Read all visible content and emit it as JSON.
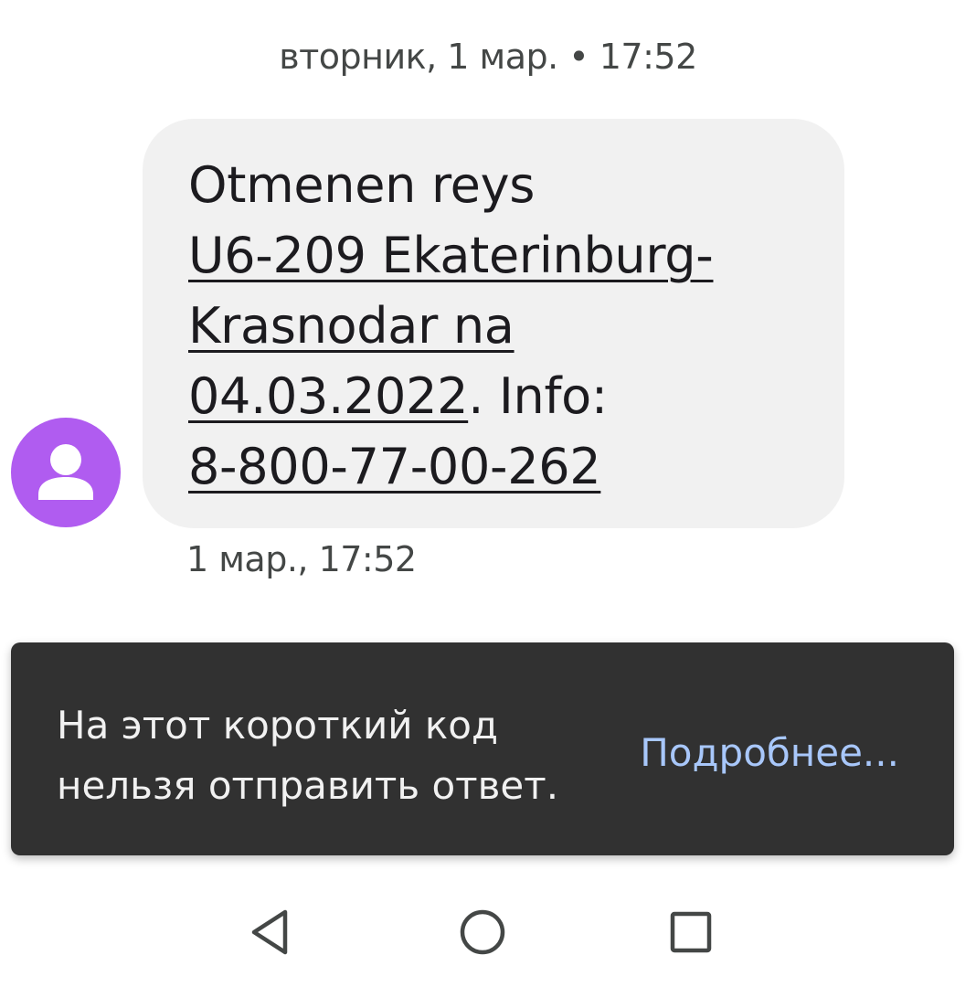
{
  "thread": {
    "date_header": "вторник, 1 мар. • 17:52"
  },
  "message": {
    "line1": "Otmenen reys",
    "flight_link": "U6-209 Ekaterinburg-",
    "flight_link_cont": "Krasnodar na",
    "date_link": "04.03.2022",
    "info_text": ". Info:",
    "phone_link": "8-800-77-00-262",
    "timestamp": "1 мар., 17:52",
    "avatar_color": "#b05cf0",
    "bubble_color": "#f1f1f1"
  },
  "snackbar": {
    "text": "На этот короткий код нельзя отправить ответ.",
    "action_label": "Подробнее...",
    "action_color": "#a8c7fa",
    "background": "#313131"
  },
  "navigation": {
    "back_icon": "back-triangle-icon",
    "home_icon": "home-circle-icon",
    "recents_icon": "recents-square-icon"
  }
}
